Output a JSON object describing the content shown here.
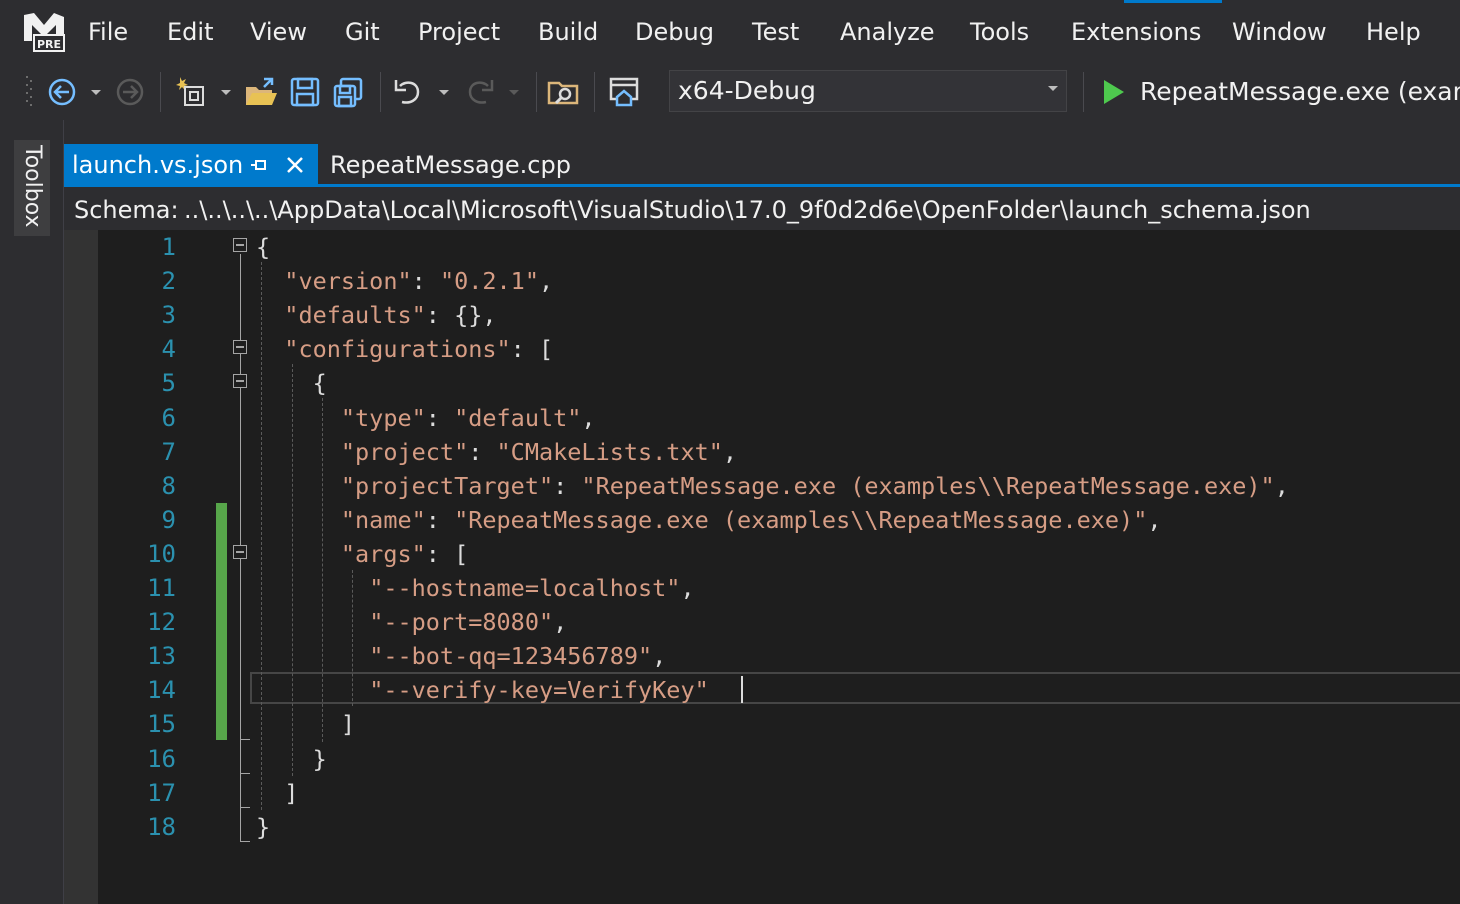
{
  "menu": {
    "items": [
      "File",
      "Edit",
      "View",
      "Git",
      "Project",
      "Build",
      "Debug",
      "Test",
      "Analyze",
      "Tools",
      "Extensions",
      "Window",
      "Help"
    ],
    "logo_badge": "PRE"
  },
  "toolbar": {
    "config": "x64-Debug",
    "run_label": "RepeatMessage.exe (examp"
  },
  "sidebar": {
    "toolbox": "Toolbox"
  },
  "tabs": [
    {
      "label": "launch.vs.json",
      "active": true
    },
    {
      "label": "RepeatMessage.cpp",
      "active": false
    }
  ],
  "schema": {
    "label": "Schema:",
    "path": "..\\..\\..\\..\\AppData\\Local\\Microsoft\\VisualStudio\\17.0_9f0d2d6e\\OpenFolder\\launch_schema.json"
  },
  "editor": {
    "line_numbers": [
      "1",
      "2",
      "3",
      "4",
      "5",
      "6",
      "7",
      "8",
      "9",
      "10",
      "11",
      "12",
      "13",
      "14",
      "15",
      "16",
      "17",
      "18"
    ],
    "lines": [
      [
        {
          "t": "{",
          "c": "p"
        }
      ],
      [
        {
          "t": "  ",
          "c": "p"
        },
        {
          "t": "\"version\"",
          "c": "k"
        },
        {
          "t": ": ",
          "c": "p"
        },
        {
          "t": "\"0.2.1\"",
          "c": "s"
        },
        {
          "t": ",",
          "c": "p"
        }
      ],
      [
        {
          "t": "  ",
          "c": "p"
        },
        {
          "t": "\"defaults\"",
          "c": "k"
        },
        {
          "t": ": {},",
          "c": "p"
        }
      ],
      [
        {
          "t": "  ",
          "c": "p"
        },
        {
          "t": "\"configurations\"",
          "c": "k"
        },
        {
          "t": ": [",
          "c": "p"
        }
      ],
      [
        {
          "t": "    {",
          "c": "p"
        }
      ],
      [
        {
          "t": "      ",
          "c": "p"
        },
        {
          "t": "\"type\"",
          "c": "k"
        },
        {
          "t": ": ",
          "c": "p"
        },
        {
          "t": "\"default\"",
          "c": "s"
        },
        {
          "t": ",",
          "c": "p"
        }
      ],
      [
        {
          "t": "      ",
          "c": "p"
        },
        {
          "t": "\"project\"",
          "c": "k"
        },
        {
          "t": ": ",
          "c": "p"
        },
        {
          "t": "\"CMakeLists.txt\"",
          "c": "s"
        },
        {
          "t": ",",
          "c": "p"
        }
      ],
      [
        {
          "t": "      ",
          "c": "p"
        },
        {
          "t": "\"projectTarget\"",
          "c": "k"
        },
        {
          "t": ": ",
          "c": "p"
        },
        {
          "t": "\"RepeatMessage.exe (examples\\\\RepeatMessage.exe)\"",
          "c": "s"
        },
        {
          "t": ",",
          "c": "p"
        }
      ],
      [
        {
          "t": "      ",
          "c": "p"
        },
        {
          "t": "\"name\"",
          "c": "k"
        },
        {
          "t": ": ",
          "c": "p"
        },
        {
          "t": "\"RepeatMessage.exe (examples\\\\RepeatMessage.exe)\"",
          "c": "s"
        },
        {
          "t": ",",
          "c": "p"
        }
      ],
      [
        {
          "t": "      ",
          "c": "p"
        },
        {
          "t": "\"args\"",
          "c": "k"
        },
        {
          "t": ": [",
          "c": "p"
        }
      ],
      [
        {
          "t": "        ",
          "c": "p"
        },
        {
          "t": "\"--hostname=localhost\"",
          "c": "s"
        },
        {
          "t": ",",
          "c": "p"
        }
      ],
      [
        {
          "t": "        ",
          "c": "p"
        },
        {
          "t": "\"--port=8080\"",
          "c": "s"
        },
        {
          "t": ",",
          "c": "p"
        }
      ],
      [
        {
          "t": "        ",
          "c": "p"
        },
        {
          "t": "\"--bot-qq=123456789\"",
          "c": "s"
        },
        {
          "t": ",",
          "c": "p"
        }
      ],
      [
        {
          "t": "        ",
          "c": "p"
        },
        {
          "t": "\"--verify-key=VerifyKey\"",
          "c": "s"
        }
      ],
      [
        {
          "t": "      ]",
          "c": "p"
        }
      ],
      [
        {
          "t": "    }",
          "c": "p"
        }
      ],
      [
        {
          "t": "  ]",
          "c": "p"
        }
      ],
      [
        {
          "t": "}",
          "c": "p"
        }
      ]
    ]
  },
  "colors": {
    "accent": "#007acc",
    "changed": "#57a64a",
    "line_number": "#2b91af",
    "string": "#d69d85"
  }
}
